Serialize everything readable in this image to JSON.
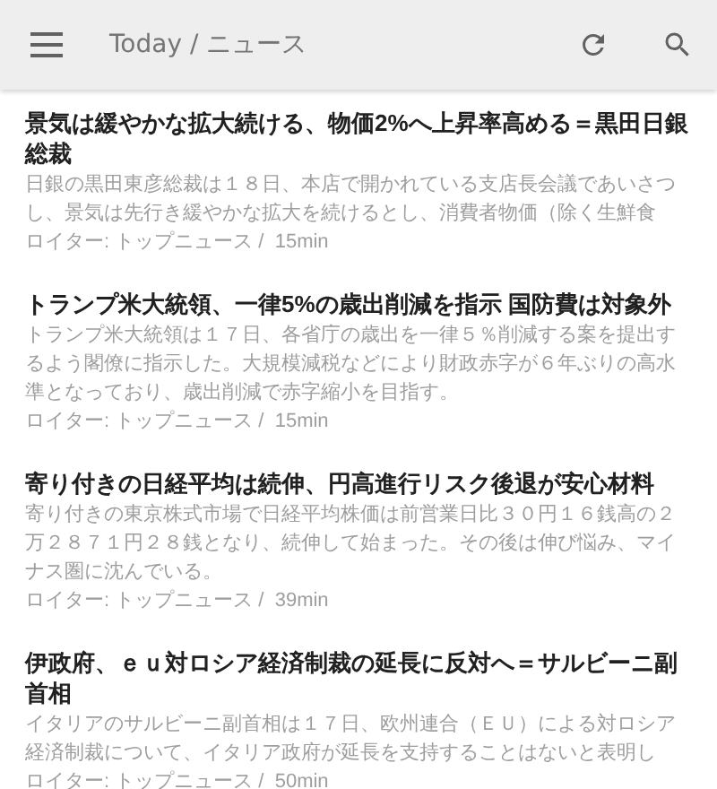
{
  "app_bar": {
    "title": "Today / ニュース"
  },
  "articles": [
    {
      "title": "景気は緩やかな拡大続ける、物価2%へ上昇率高める＝黒田日銀総裁",
      "summary": "日銀の黒田東彦総裁は１８日、本店で開かれている支店長会議であいさつし、景気は先行き緩やかな拡大を続けるとし、消費者物価（除く生鮮食",
      "source": "ロイター: トップニュース /  15min"
    },
    {
      "title": "トランプ米大統領、一律5%の歳出削減を指示 国防費は対象外",
      "summary": "トランプ米大統領は１７日、各省庁の歳出を一律５％削減する案を提出するよう閣僚に指示した。大規模減税などにより財政赤字が６年ぶりの高水準となっており、歳出削減で赤字縮小を目指す。",
      "source": "ロイター: トップニュース /  15min"
    },
    {
      "title": "寄り付きの日経平均は続伸、円高進行リスク後退が安心材料",
      "summary": "寄り付きの東京株式市場で日経平均株価は前営業日比３０円１６銭高の２万２８７１円２８銭となり、続伸して始まった。その後は伸び悩み、マイナス圏に沈んでいる。",
      "source": "ロイター: トップニュース /  39min"
    },
    {
      "title": "伊政府、ｅｕ対ロシア経済制裁の延長に反対へ＝サルビーニ副首相",
      "summary": "イタリアのサルビーニ副首相は１７日、欧州連合（ＥＵ）による対ロシア経済制裁について、イタリア政府が延長を支持することはないと表明し",
      "source": "ロイター: トップニュース /  50min"
    }
  ]
}
